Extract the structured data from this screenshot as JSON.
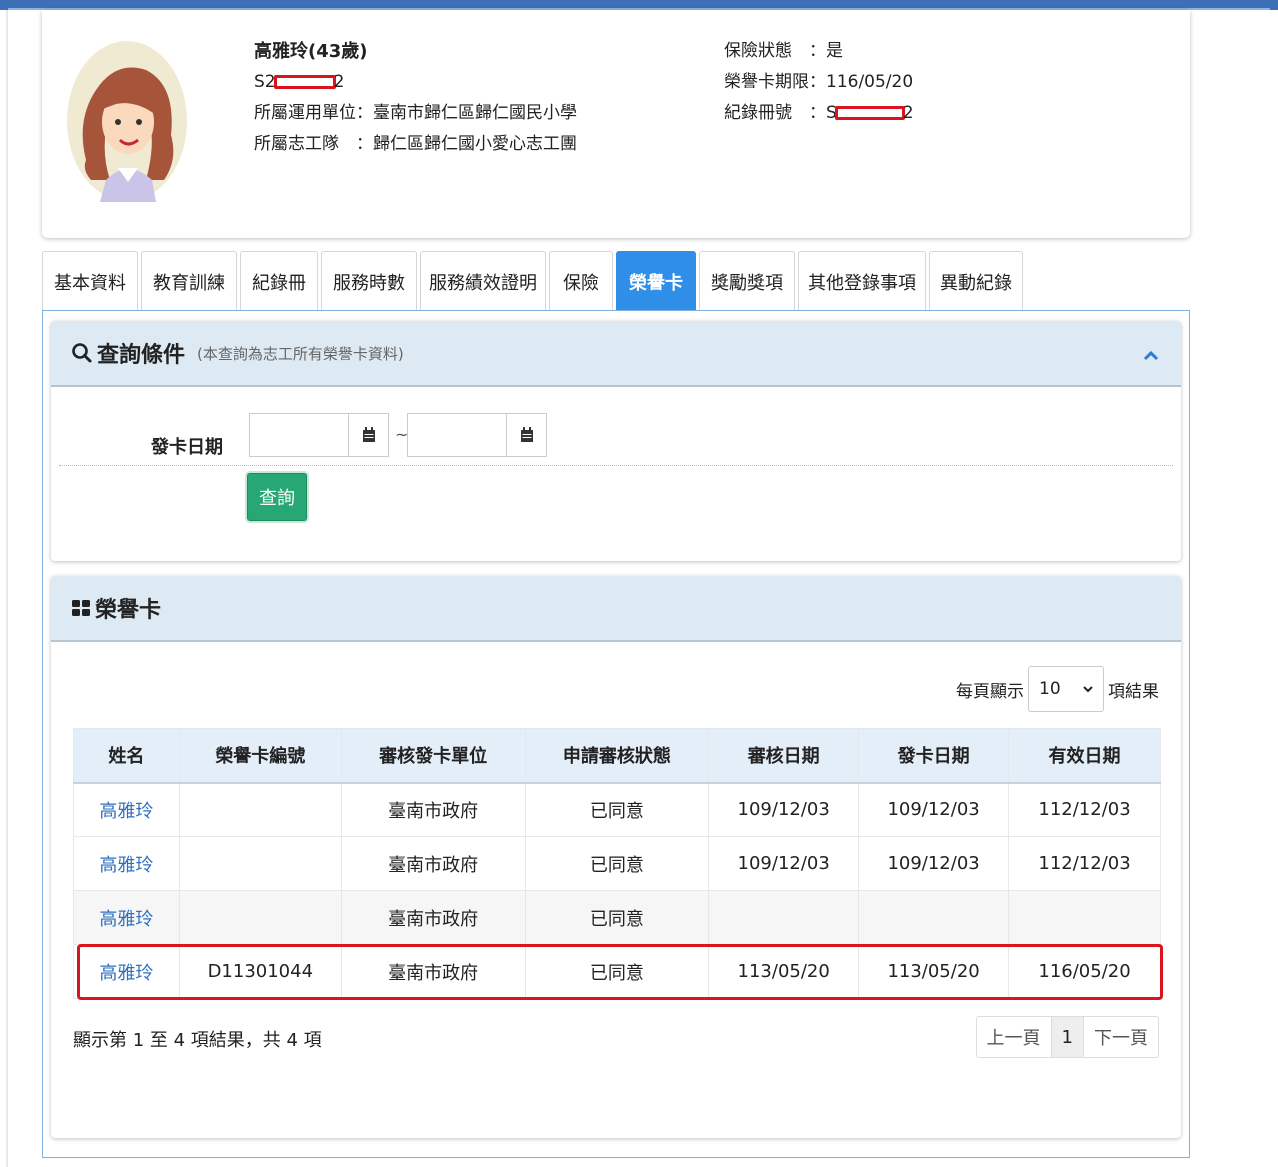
{
  "profile": {
    "name": "高雅玲(43歲)",
    "id_prefix": "S2",
    "id_suffix": "2",
    "unit_label": "所屬運用單位：",
    "unit_value": "臺南市歸仁區歸仁國民小學",
    "team_label": "所屬志工隊　：",
    "team_value": "歸仁區歸仁國小愛心志工團",
    "insurance_label": "保險狀態　：",
    "insurance_value": "是",
    "card_expiry_label": "榮譽卡期限：",
    "card_expiry_value": "116/05/20",
    "record_label": "紀錄冊號　：",
    "record_prefix": "S",
    "record_suffix": "2"
  },
  "tabs": [
    {
      "label": "基本資料"
    },
    {
      "label": "教育訓練"
    },
    {
      "label": "紀錄冊"
    },
    {
      "label": "服務時數"
    },
    {
      "label": "服務績效證明"
    },
    {
      "label": "保險"
    },
    {
      "label": "榮譽卡",
      "active": true
    },
    {
      "label": "獎勵獎項"
    },
    {
      "label": "其他登錄事項"
    },
    {
      "label": "異動紀錄"
    }
  ],
  "query": {
    "title": "查詢條件",
    "subtitle": "(本查詢為志工所有榮譽卡資料)",
    "field_label": "發卡日期",
    "tilde": "~",
    "start_value": "",
    "end_value": "",
    "button_label": "查詢"
  },
  "results": {
    "title": "榮譽卡",
    "page_size_prefix": "每頁顯示",
    "page_size_value": "10",
    "page_size_suffix": "項結果",
    "columns": [
      "姓名",
      "榮譽卡編號",
      "審核發卡單位",
      "申請審核狀態",
      "審核日期",
      "發卡日期",
      "有效日期"
    ],
    "rows": [
      {
        "name": "高雅玲",
        "card_no": "",
        "unit": "臺南市政府",
        "status": "已同意",
        "review_date": "109/12/03",
        "issue_date": "109/12/03",
        "valid_date": "112/12/03"
      },
      {
        "name": "高雅玲",
        "card_no": "",
        "unit": "臺南市政府",
        "status": "已同意",
        "review_date": "109/12/03",
        "issue_date": "109/12/03",
        "valid_date": "112/12/03"
      },
      {
        "name": "高雅玲",
        "card_no": "",
        "unit": "臺南市政府",
        "status": "已同意",
        "review_date": "",
        "issue_date": "",
        "valid_date": ""
      },
      {
        "name": "高雅玲",
        "card_no": "D11301044",
        "unit": "臺南市政府",
        "status": "已同意",
        "review_date": "113/05/20",
        "issue_date": "113/05/20",
        "valid_date": "116/05/20"
      }
    ],
    "info": "顯示第 1 至 4 項結果，共 4 項",
    "pager": {
      "prev": "上一頁",
      "current": "1",
      "next": "下一頁"
    }
  },
  "colors": {
    "accent": "#2e8ee8",
    "query_button": "#26a774",
    "highlight": "#d9141c",
    "link": "#2e6fbf"
  }
}
